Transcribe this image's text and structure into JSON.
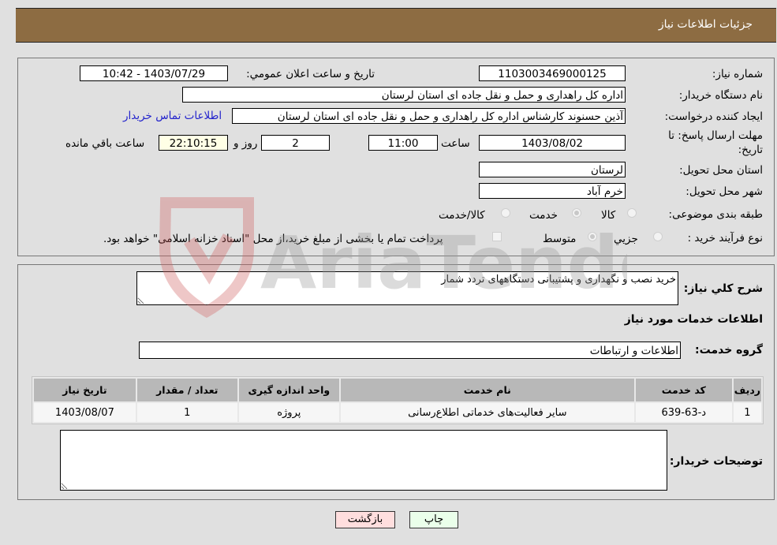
{
  "header": {
    "title": "جزئیات اطلاعات نیاز"
  },
  "form": {
    "need_number_label": "شماره نیاز:",
    "need_number": "1103003469000125",
    "announce_label": "تاریخ و ساعت اعلان عمومي:",
    "announce_value": "1403/07/29 - 10:42",
    "buyer_org_label": "نام دستگاه خریدار:",
    "buyer_org": "اداره کل راهداری و حمل و نقل جاده ای استان لرستان",
    "creator_label": "ایجاد کننده درخواست:",
    "creator": "آذین حسنوند کارشناس اداره کل راهداری و حمل و نقل جاده ای استان لرستان",
    "contact_link": "اطلاعات تماس خریدار",
    "deadline_label_line1": "مهلت ارسال پاسخ: تا",
    "deadline_label_line2": "تاریخ:",
    "deadline_date": "1403/08/02",
    "time_label": "ساعت",
    "deadline_time": "11:00",
    "days_value": "2",
    "days_label": "روز و",
    "remaining_time": "22:10:15",
    "remaining_label": "ساعت باقي مانده",
    "province_label": "استان محل تحویل:",
    "province": "لرستان",
    "city_label": "شهر محل تحویل:",
    "city": "خرم آباد",
    "category_label": "طبقه بندی موضوعی:",
    "category_options": [
      {
        "label": "کالا",
        "selected": false
      },
      {
        "label": "خدمت",
        "selected": true
      },
      {
        "label": "کالا/خدمت",
        "selected": false
      }
    ],
    "process_label": "نوع فرآیند خرید :",
    "process_options": [
      {
        "label": "جزيي",
        "selected": false
      },
      {
        "label": "متوسط",
        "selected": true
      }
    ],
    "treasury_checkbox_label": "پرداخت تمام یا بخشی از مبلغ خرید،از محل \"اسناد خزانه اسلامی\" خواهد بود.",
    "treasury_checked": false
  },
  "details": {
    "description_label": "شرح کلي نیاز:",
    "description": "خرید نصب و نگهداری و پشتیبانی دستگاههای تردد شمار",
    "services_heading": "اطلاعات خدمات مورد نیاز",
    "service_group_label": "گروه خدمت:",
    "service_group": "اطلاعات و ارتباطات",
    "table": {
      "headers": [
        "ردیف",
        "کد خدمت",
        "نام خدمت",
        "واحد اندازه گیری",
        "تعداد / مقدار",
        "تاریخ نیاز"
      ],
      "rows": [
        [
          "1",
          "د-63-639",
          "سایر فعالیت‌های خدماتی اطلاع‌رسانی",
          "پروژه",
          "1",
          "1403/08/07"
        ]
      ]
    },
    "buyer_notes_label": "توضیحات خریدار:",
    "buyer_notes": ""
  },
  "buttons": {
    "print": "چاپ",
    "back": "بازگشت"
  },
  "watermark": {
    "text": "AriaTender.neT"
  }
}
